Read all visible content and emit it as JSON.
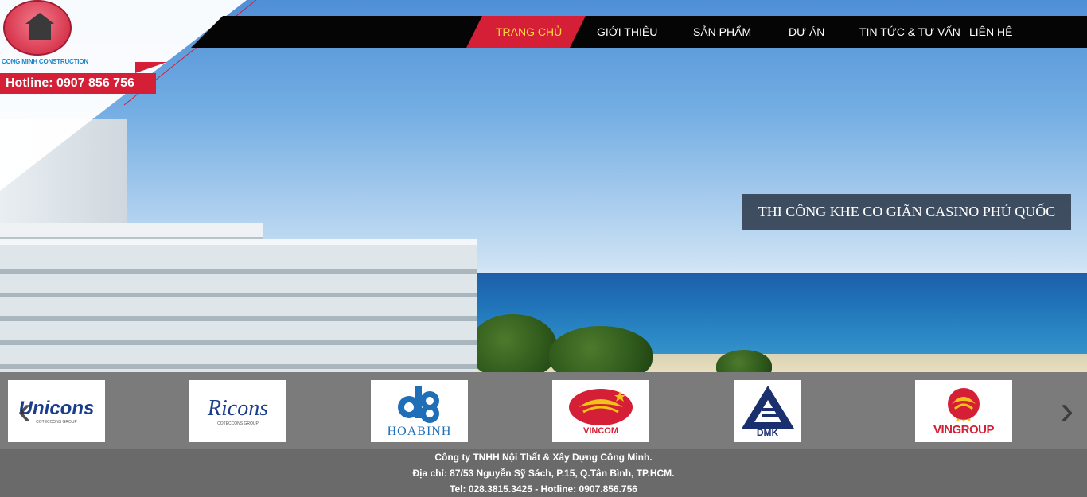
{
  "brand": {
    "logo_text": "CONG MINH CONSTRUCTION",
    "hotline": "Hotline: 0907 856 756"
  },
  "nav": {
    "items": [
      {
        "label": "TRANG CHỦ",
        "active": true
      },
      {
        "label": "GIỚI THIỆU",
        "active": false
      },
      {
        "label": "SẢN PHẨM",
        "active": false
      },
      {
        "label": "DỰ ÁN",
        "active": false
      },
      {
        "label": "TIN TỨC & TƯ VẤN",
        "active": false
      },
      {
        "label": "LIÊN HỆ",
        "active": false
      }
    ]
  },
  "slider": {
    "caption": "THI CÔNG KHE CO GIÃN CASINO PHÚ QUỐC"
  },
  "partners": {
    "items": [
      {
        "name": "Unicons",
        "sub": "COTECCONS GROUP",
        "color": "#1a3e8c",
        "accent": "#d41f36"
      },
      {
        "name": "Ricons",
        "sub": "COTECCONS GROUP",
        "color": "#1a3e8c",
        "accent": "#d41f36"
      },
      {
        "name": "HOABINH",
        "sub": "",
        "color": "#1f6fb8",
        "accent": "#1f6fb8"
      },
      {
        "name": "VINCOM",
        "sub": "",
        "color": "#d41f36",
        "accent": "#f2c21b"
      },
      {
        "name": "DMK",
        "sub": "",
        "color": "#1a2f6e",
        "accent": "#1a2f6e"
      },
      {
        "name": "VINGROUP",
        "sub": "",
        "color": "#d41f36",
        "accent": "#f2c21b"
      }
    ]
  },
  "footer": {
    "company": "Công ty TNHH Nội Thất & Xây Dựng Công Minh.",
    "address": "Địa chỉ: 87/53 Nguyễn Sỹ Sách, P.15, Q.Tân Bình, TP.HCM.",
    "contact": "Tel: 028.3815.3425 - Hotline: 0907.856.756"
  },
  "colors": {
    "brand_red": "#d41f36",
    "nav_active_text": "#ffd83a",
    "nav_bg": "#050505"
  }
}
